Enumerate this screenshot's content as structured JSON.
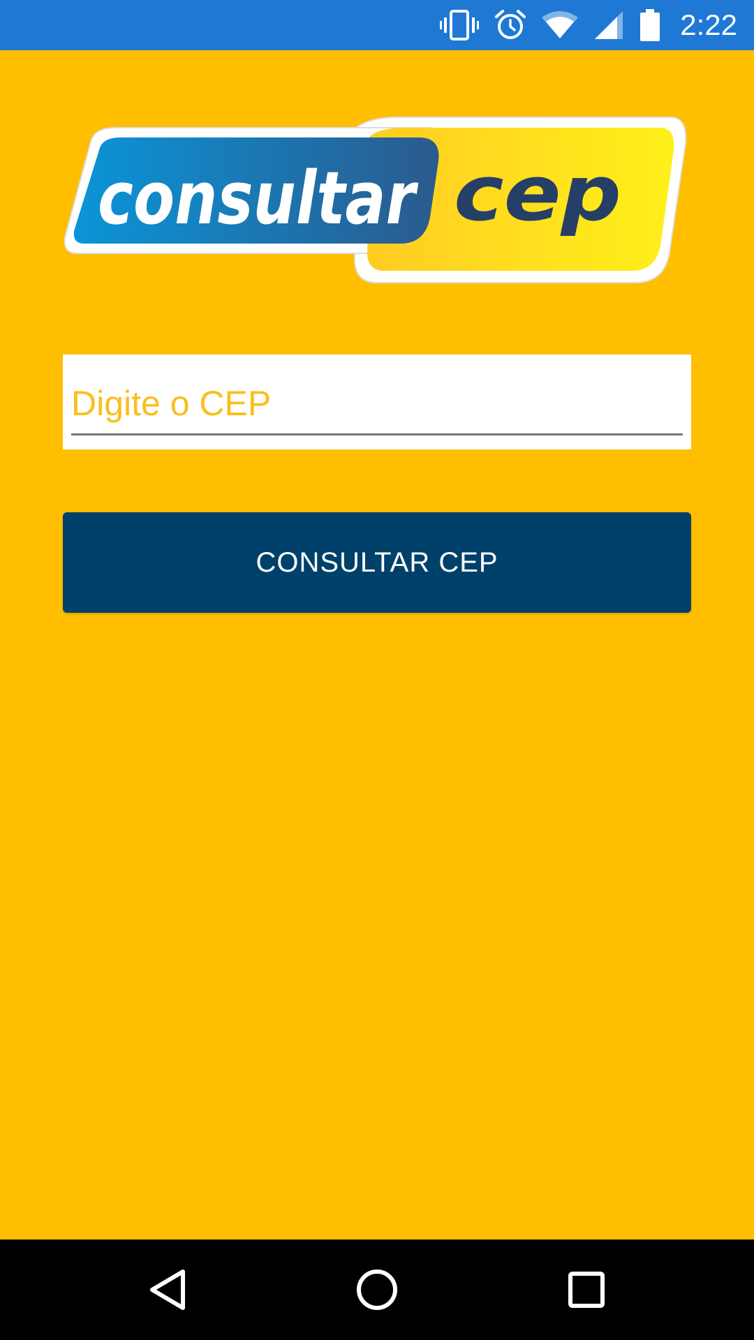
{
  "status_bar": {
    "time": "2:22",
    "icons": [
      "vibrate-icon",
      "alarm-icon",
      "wifi-icon",
      "cell-signal-icon",
      "battery-icon"
    ]
  },
  "logo": {
    "word_left": "consultar",
    "word_right": "cep"
  },
  "form": {
    "cep_placeholder": "Digite o CEP",
    "cep_value": "",
    "submit_label": "CONSULTAR CEP"
  },
  "nav_bar": {
    "icons": [
      "back-icon",
      "home-icon",
      "recent-apps-icon"
    ]
  },
  "colors": {
    "background": "#FFBE00",
    "status_bar": "#1E78D4",
    "button": "#00416B",
    "placeholder": "#F9BF1C",
    "logo_blue": "#0A8AD0",
    "logo_yellow": "#FFD21E",
    "logo_text_dark": "#253F66"
  }
}
